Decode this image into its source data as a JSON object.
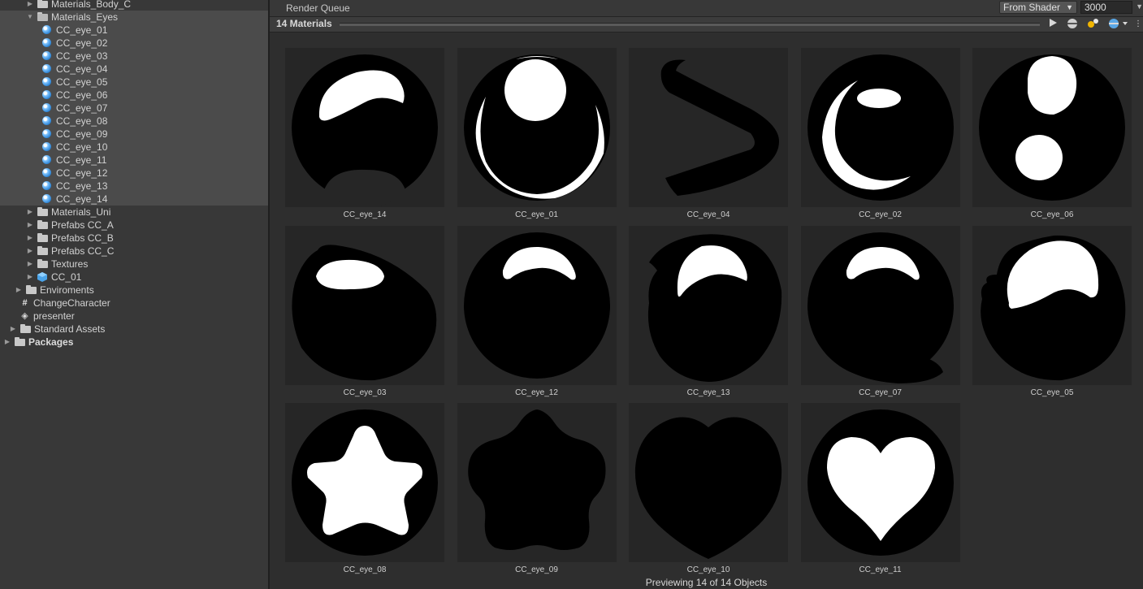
{
  "tree": {
    "items": [
      {
        "label": "Materials_Body_C",
        "type": "folder",
        "indent": 2,
        "arrow": "right",
        "selected": false,
        "cut": true
      },
      {
        "label": "Materials_Eyes",
        "type": "folder-open",
        "indent": 2,
        "arrow": "down",
        "selected": true
      },
      {
        "label": "CC_eye_01",
        "type": "material",
        "indent": 3,
        "selected": true
      },
      {
        "label": "CC_eye_02",
        "type": "material",
        "indent": 3,
        "selected": true
      },
      {
        "label": "CC_eye_03",
        "type": "material",
        "indent": 3,
        "selected": true
      },
      {
        "label": "CC_eye_04",
        "type": "material",
        "indent": 3,
        "selected": true
      },
      {
        "label": "CC_eye_05",
        "type": "material",
        "indent": 3,
        "selected": true
      },
      {
        "label": "CC_eye_06",
        "type": "material",
        "indent": 3,
        "selected": true
      },
      {
        "label": "CC_eye_07",
        "type": "material",
        "indent": 3,
        "selected": true
      },
      {
        "label": "CC_eye_08",
        "type": "material",
        "indent": 3,
        "selected": true
      },
      {
        "label": "CC_eye_09",
        "type": "material",
        "indent": 3,
        "selected": true
      },
      {
        "label": "CC_eye_10",
        "type": "material",
        "indent": 3,
        "selected": true
      },
      {
        "label": "CC_eye_11",
        "type": "material",
        "indent": 3,
        "selected": true
      },
      {
        "label": "CC_eye_12",
        "type": "material",
        "indent": 3,
        "selected": true
      },
      {
        "label": "CC_eye_13",
        "type": "material",
        "indent": 3,
        "selected": true
      },
      {
        "label": "CC_eye_14",
        "type": "material",
        "indent": 3,
        "selected": true
      },
      {
        "label": "Materials_Uni",
        "type": "folder",
        "indent": 2,
        "arrow": "right",
        "selected": false
      },
      {
        "label": "Prefabs CC_A",
        "type": "folder",
        "indent": 2,
        "arrow": "right",
        "selected": false
      },
      {
        "label": "Prefabs CC_B",
        "type": "folder",
        "indent": 2,
        "arrow": "right",
        "selected": false
      },
      {
        "label": "Prefabs CC_C",
        "type": "folder",
        "indent": 2,
        "arrow": "right",
        "selected": false
      },
      {
        "label": "Textures",
        "type": "folder",
        "indent": 2,
        "arrow": "right",
        "selected": false
      },
      {
        "label": "CC_01",
        "type": "prefab",
        "indent": 2,
        "arrow": "right",
        "selected": false
      },
      {
        "label": "Enviroments",
        "type": "folder",
        "indent": 1,
        "arrow": "right",
        "selected": false
      },
      {
        "label": "ChangeCharacter",
        "type": "script",
        "indent": 1,
        "selected": false
      },
      {
        "label": "presenter",
        "type": "scene",
        "indent": 1,
        "selected": false
      },
      {
        "label": "Standard Assets",
        "type": "folder",
        "indent": 0.5,
        "arrow": "right",
        "selected": false
      },
      {
        "label": "Packages",
        "type": "folder",
        "indent": 0,
        "arrow": "right",
        "selected": false,
        "bold": true
      }
    ]
  },
  "render_queue": {
    "label": "Render Queue",
    "mode": "From Shader",
    "value": "3000"
  },
  "preview": {
    "count_label": "14 Materials",
    "footer": "Previewing 14 of 14 Objects",
    "tools": {
      "play": "play-icon",
      "sphere": "sphere-icon",
      "light": "light-icon",
      "env": "environment-icon",
      "menu": "kebab-menu-icon"
    },
    "tiles": [
      {
        "name": "CC_eye_14",
        "shape": "eye14"
      },
      {
        "name": "CC_eye_01",
        "shape": "eye01"
      },
      {
        "name": "CC_eye_04",
        "shape": "eye04"
      },
      {
        "name": "CC_eye_02",
        "shape": "eye02"
      },
      {
        "name": "CC_eye_06",
        "shape": "eye06"
      },
      {
        "name": "CC_eye_03",
        "shape": "eye03"
      },
      {
        "name": "CC_eye_12",
        "shape": "eye12"
      },
      {
        "name": "CC_eye_13",
        "shape": "eye13"
      },
      {
        "name": "CC_eye_07",
        "shape": "eye07"
      },
      {
        "name": "CC_eye_05",
        "shape": "eye05"
      },
      {
        "name": "CC_eye_08",
        "shape": "eye08"
      },
      {
        "name": "CC_eye_09",
        "shape": "eye09"
      },
      {
        "name": "CC_eye_10",
        "shape": "eye10"
      },
      {
        "name": "CC_eye_11",
        "shape": "eye11"
      }
    ]
  }
}
